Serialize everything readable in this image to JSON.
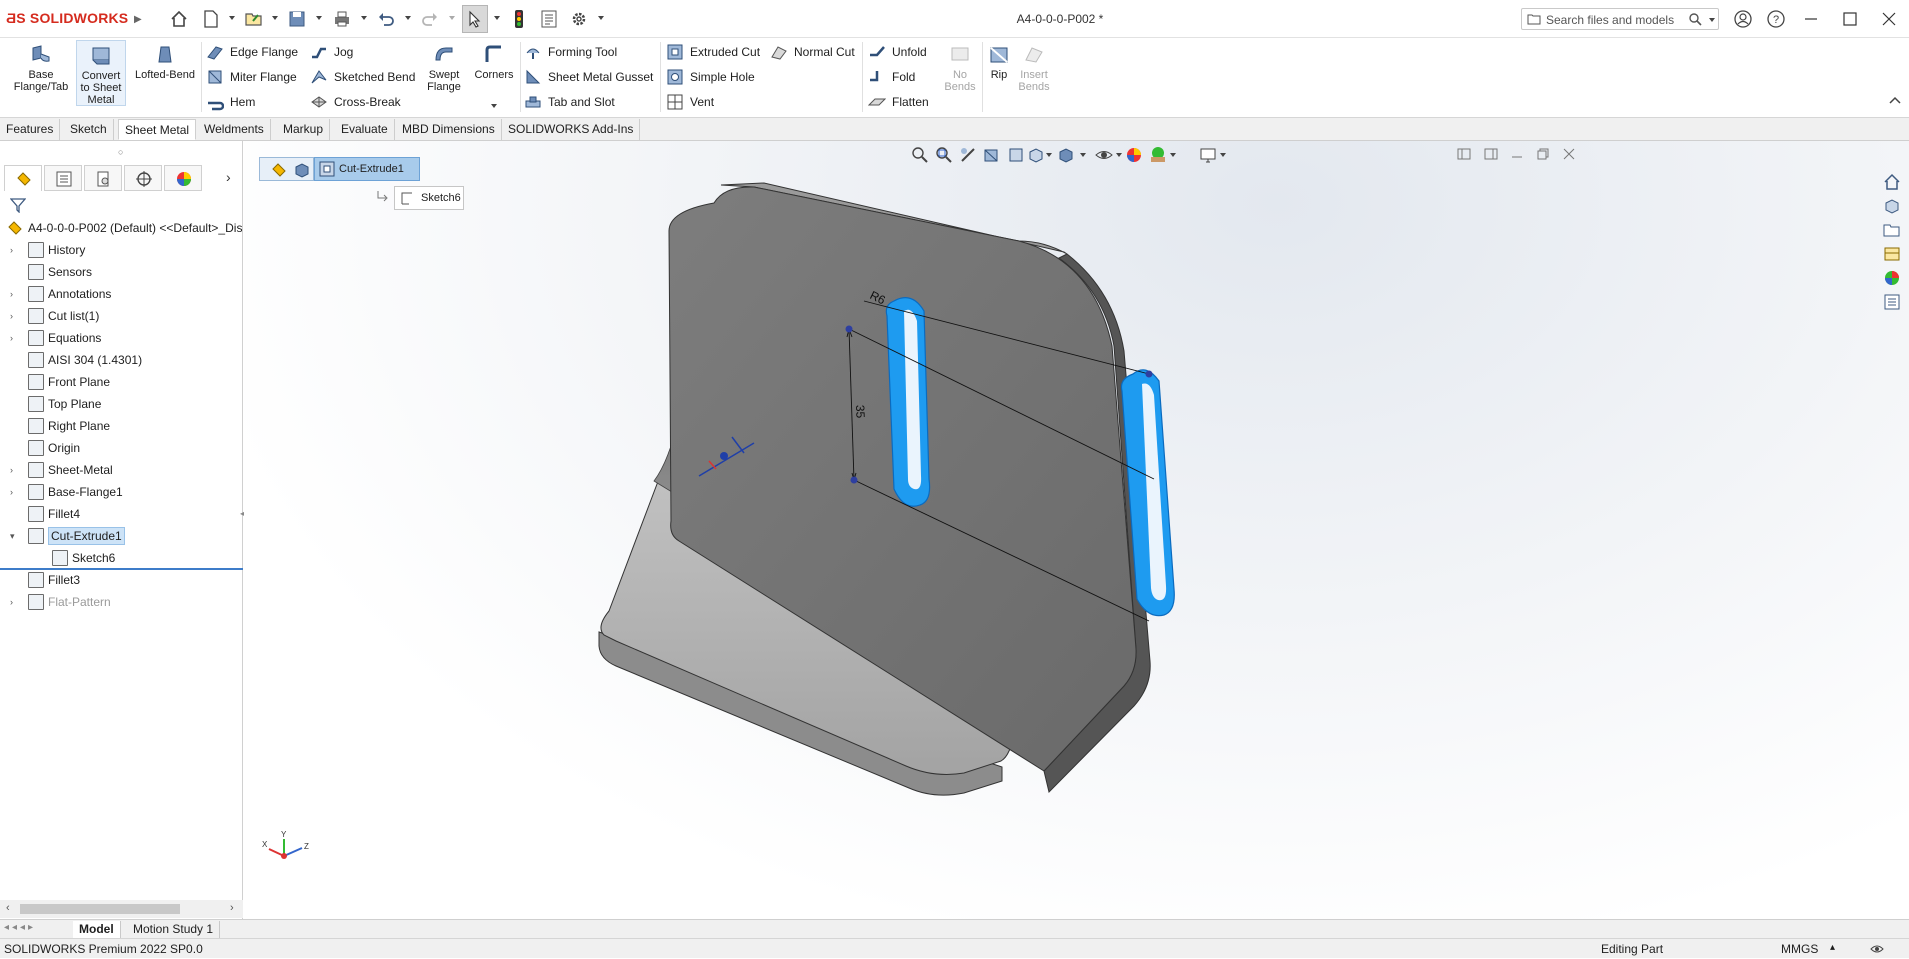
{
  "app": {
    "brand": "SOLIDWORKS",
    "document_title": "A4-0-0-0-P002 *"
  },
  "search": {
    "placeholder": "Search files and models"
  },
  "ribbon": {
    "base_flange": "Base Flange/Tab",
    "convert": "Convert to Sheet Metal",
    "lofted_bend": "Lofted-Bend",
    "edge_flange": "Edge Flange",
    "miter_flange": "Miter Flange",
    "hem": "Hem",
    "jog": "Jog",
    "sketched_bend": "Sketched Bend",
    "cross_break": "Cross-Break",
    "swept_flange": "Swept Flange",
    "corners": "Corners",
    "forming_tool": "Forming Tool",
    "gusset": "Sheet Metal Gusset",
    "tab_slot": "Tab and Slot",
    "extruded_cut": "Extruded Cut",
    "simple_hole": "Simple Hole",
    "vent": "Vent",
    "normal_cut": "Normal Cut",
    "unfold": "Unfold",
    "fold": "Fold",
    "flatten": "Flatten",
    "no_bends": "No Bends",
    "rip": "Rip",
    "insert_bends": "Insert Bends"
  },
  "tabs": [
    "Features",
    "Sketch",
    "Sheet Metal",
    "Weldments",
    "Markup",
    "Evaluate",
    "MBD Dimensions",
    "SOLIDWORKS Add-Ins"
  ],
  "active_tab": "Sheet Metal",
  "tree": {
    "root": "A4-0-0-0-P002 (Default) <<Default>_Dis",
    "items": [
      {
        "label": "History",
        "expand": true
      },
      {
        "label": "Sensors",
        "expand": false
      },
      {
        "label": "Annotations",
        "expand": true
      },
      {
        "label": "Cut list(1)",
        "expand": true
      },
      {
        "label": "Equations",
        "expand": true
      },
      {
        "label": "AISI 304 (1.4301)",
        "expand": false
      },
      {
        "label": "Front Plane",
        "expand": false
      },
      {
        "label": "Top Plane",
        "expand": false
      },
      {
        "label": "Right Plane",
        "expand": false
      },
      {
        "label": "Origin",
        "expand": false
      },
      {
        "label": "Sheet-Metal",
        "expand": true
      },
      {
        "label": "Base-Flange1",
        "expand": true
      },
      {
        "label": "Fillet4",
        "expand": false
      },
      {
        "label": "Cut-Extrude1",
        "expand": true,
        "selected": true
      },
      {
        "label": "Sketch6",
        "expand": false,
        "child": true
      },
      {
        "label": "Fillet3",
        "expand": false
      },
      {
        "label": "Flat-Pattern",
        "expand": true,
        "disabled": true
      }
    ]
  },
  "breadcrumb": {
    "feature": "Cut-Extrude1",
    "sketch": "Sketch6"
  },
  "dimensions": {
    "radius": "R6",
    "length": "35"
  },
  "triad": {
    "x": "X",
    "y": "Y",
    "z": "Z"
  },
  "bottom_tabs": [
    "Model",
    "Motion Study 1"
  ],
  "status": {
    "version": "SOLIDWORKS Premium 2022 SP0.0",
    "mode": "Editing Part",
    "units": "MMGS"
  },
  "colors": {
    "accent": "#d52b1e",
    "selection_blue": "#1e9bf0",
    "part_gray": "#8a8a8a"
  }
}
